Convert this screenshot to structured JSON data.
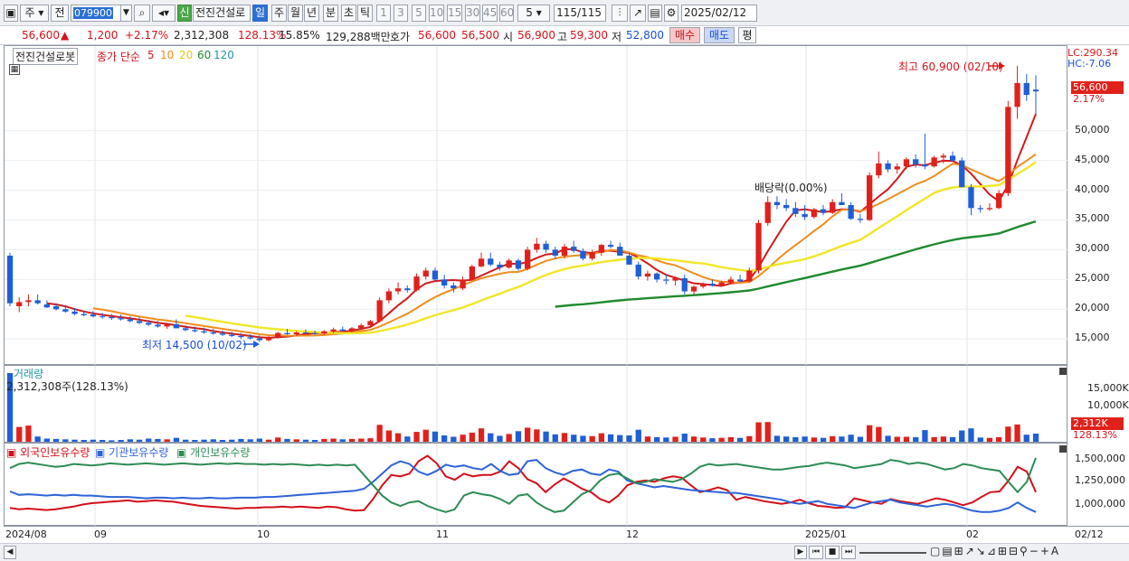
{
  "toolbar": {
    "market": "주",
    "market2": "전",
    "code": "079900",
    "name_badge": "신",
    "stock_name": "전진건설로",
    "periods": [
      "일",
      "주",
      "월",
      "년",
      "분",
      "초",
      "틱"
    ],
    "intervals": [
      "1",
      "3",
      "5",
      "10",
      "15",
      "30",
      "45",
      "60"
    ],
    "interval_value": "5",
    "count": "115/115",
    "date": "2025/02/12"
  },
  "quote": {
    "price": "56,600",
    "arrow": "▲",
    "change": "1,200",
    "change_pct": "+2.17%",
    "volume": "2,312,308",
    "vol_ratio": "128.13%",
    "turnover": "15.85%",
    "amount": "129,288백만",
    "ask_label": "호가",
    "ask": "56,600",
    "bid": "56,500",
    "open_label": "시",
    "open": "56,900",
    "high_label": "고",
    "high": "59,300",
    "low_label": "저",
    "low": "52,800",
    "buy_button": "매수",
    "sell_button": "매도",
    "eval_button": "평"
  },
  "price_pane": {
    "name_tag": "전진건설로봇",
    "legend_label": "종가 단순",
    "ma_labels": [
      "5",
      "10",
      "20",
      "60",
      "120"
    ],
    "lc_label": "LC:290.34",
    "hc_label": "HC:-7.06",
    "last_price_tag": "56,600",
    "last_pct_tag": "2.17%",
    "high_note": "최고 60,900 (02/10)",
    "low_note": "최저 14,500 (10/02)",
    "dividend_note": "배당락(0.00%)",
    "y_ticks": [
      "50,000",
      "45,000",
      "40,000",
      "35,000",
      "30,000",
      "25,000",
      "20,000",
      "15,000"
    ]
  },
  "volume_pane": {
    "title": "거래량",
    "current": "2,312,308주(128.13%)",
    "y_ticks": [
      "15,000K",
      "10,000K"
    ],
    "last_tag": "2,312K",
    "last_pct_tag": "128.13%"
  },
  "holdings_pane": {
    "legend": [
      "외국인보유수량",
      "기관보유수량",
      "개인보유수량"
    ],
    "y_ticks": [
      "1,500,000",
      "1,250,000",
      "1,000,000"
    ]
  },
  "xaxis": {
    "labels": [
      "2024/08",
      "09",
      "10",
      "11",
      "12",
      "2025/01",
      "02"
    ],
    "right_label": "02/12"
  },
  "colors": {
    "up": "#e0211b",
    "down": "#1f5fd6",
    "ma5": "#d01c1c",
    "ma10": "#f08c1e",
    "ma20": "#f2e626",
    "ma60": "#1f8a2e",
    "ma120": "#2196a8",
    "foreign": "#d40f1a",
    "institution": "#2e63d8",
    "individual": "#2d8c55"
  },
  "chart_data": {
    "type": "candlestick",
    "series_note": "daily OHLC, ~115 sessions from 2024/08 to 2025/02/12",
    "y_range": [
      12000,
      63000
    ],
    "ohlc": [
      [
        29000,
        29500,
        20500,
        21000
      ],
      [
        20500,
        22000,
        19500,
        21200
      ],
      [
        21200,
        22500,
        20500,
        21500
      ],
      [
        21500,
        22500,
        20800,
        21000
      ],
      [
        20800,
        21500,
        20200,
        20300
      ],
      [
        20500,
        21000,
        19800,
        20000
      ],
      [
        20000,
        20700,
        19400,
        19600
      ],
      [
        19600,
        20200,
        19000,
        19200
      ],
      [
        19200,
        19800,
        18800,
        19000
      ],
      [
        19100,
        19700,
        18600,
        18800
      ],
      [
        18800,
        19400,
        18400,
        18700
      ],
      [
        18700,
        19200,
        18200,
        18500
      ],
      [
        18500,
        19100,
        18100,
        18300
      ],
      [
        18300,
        18800,
        17800,
        18000
      ],
      [
        18000,
        18700,
        17500,
        17700
      ],
      [
        17700,
        18200,
        17200,
        17400
      ],
      [
        17400,
        18000,
        16900,
        17100
      ],
      [
        17100,
        17700,
        16700,
        17500
      ],
      [
        17500,
        18300,
        17000,
        16800
      ],
      [
        16800,
        17300,
        16300,
        16500
      ],
      [
        16500,
        17100,
        16100,
        16300
      ],
      [
        16300,
        16900,
        15900,
        16100
      ],
      [
        16100,
        16700,
        15700,
        15900
      ],
      [
        15900,
        16400,
        15500,
        15700
      ],
      [
        15700,
        16200,
        15300,
        15500
      ],
      [
        15500,
        16000,
        15000,
        15300
      ],
      [
        15300,
        15800,
        14900,
        15100
      ],
      [
        15100,
        15600,
        14500,
        14800
      ],
      [
        14800,
        15500,
        14600,
        15300
      ],
      [
        15300,
        16200,
        15100,
        16000
      ],
      [
        16000,
        16700,
        15700,
        15800
      ],
      [
        15800,
        16300,
        15500,
        16100
      ],
      [
        16100,
        16600,
        15800,
        16000
      ],
      [
        16000,
        16400,
        15700,
        15900
      ],
      [
        15900,
        16500,
        15700,
        16300
      ],
      [
        16300,
        16900,
        16000,
        16600
      ],
      [
        16600,
        17100,
        16300,
        16400
      ],
      [
        16400,
        17000,
        16100,
        16800
      ],
      [
        16800,
        17600,
        16600,
        17300
      ],
      [
        17300,
        18200,
        17100,
        18000
      ],
      [
        18000,
        22000,
        17800,
        21500
      ],
      [
        21500,
        23500,
        21000,
        23000
      ],
      [
        23000,
        24500,
        22500,
        23500
      ],
      [
        23500,
        24000,
        22800,
        23200
      ],
      [
        23200,
        26000,
        23000,
        25500
      ],
      [
        25500,
        27000,
        25000,
        26500
      ],
      [
        26500,
        27000,
        24800,
        25000
      ],
      [
        25000,
        25800,
        23500,
        24000
      ],
      [
        24000,
        24500,
        22800,
        23500
      ],
      [
        23500,
        25500,
        23200,
        25000
      ],
      [
        25000,
        27500,
        24800,
        27200
      ],
      [
        27200,
        29500,
        27000,
        28500
      ],
      [
        28500,
        29500,
        27200,
        27500
      ],
      [
        27500,
        28000,
        26500,
        27000
      ],
      [
        27000,
        28500,
        26800,
        28200
      ],
      [
        28200,
        28500,
        26500,
        26800
      ],
      [
        26800,
        30500,
        26500,
        30000
      ],
      [
        30000,
        32000,
        29500,
        31000
      ],
      [
        31000,
        31500,
        29500,
        30000
      ],
      [
        30000,
        30500,
        28500,
        29000
      ],
      [
        29000,
        31000,
        28500,
        30500
      ],
      [
        30500,
        31500,
        29500,
        29800
      ],
      [
        29800,
        30200,
        28200,
        28500
      ],
      [
        28500,
        30000,
        28200,
        29500
      ],
      [
        29500,
        31000,
        29000,
        30800
      ],
      [
        30800,
        31500,
        30200,
        30500
      ],
      [
        30500,
        31200,
        29500,
        29000
      ],
      [
        29000,
        29500,
        27500,
        27500
      ],
      [
        27500,
        28000,
        25000,
        25500
      ],
      [
        25500,
        26500,
        24800,
        26000
      ],
      [
        26000,
        26200,
        24500,
        25000
      ],
      [
        25000,
        25800,
        24200,
        24800
      ],
      [
        24800,
        25500,
        24000,
        25200
      ],
      [
        25200,
        25800,
        22500,
        23000
      ],
      [
        23000,
        24000,
        22500,
        23800
      ],
      [
        23800,
        24500,
        23500,
        24300
      ],
      [
        24300,
        25000,
        23800,
        24000
      ],
      [
        24000,
        24800,
        23800,
        24500
      ],
      [
        24500,
        25500,
        24200,
        25000
      ],
      [
        25000,
        25800,
        24600,
        24700
      ],
      [
        24700,
        27000,
        24500,
        26500
      ],
      [
        26500,
        35000,
        26000,
        34500
      ],
      [
        34500,
        39000,
        34000,
        38000
      ],
      [
        38000,
        39000,
        36800,
        37500
      ],
      [
        37500,
        38500,
        36500,
        37000
      ],
      [
        37000,
        38000,
        35500,
        36000
      ],
      [
        36000,
        37500,
        35000,
        35500
      ],
      [
        35500,
        37000,
        35200,
        36800
      ],
      [
        36800,
        37500,
        35800,
        36200
      ],
      [
        36200,
        38500,
        36000,
        38000
      ],
      [
        38000,
        39500,
        37500,
        37500
      ],
      [
        37500,
        38000,
        35000,
        35200
      ],
      [
        35200,
        36000,
        34500,
        35000
      ],
      [
        35000,
        43000,
        34800,
        42500
      ],
      [
        42500,
        46500,
        42000,
        44500
      ],
      [
        44500,
        45000,
        43000,
        43500
      ],
      [
        43500,
        44500,
        42800,
        44000
      ],
      [
        44000,
        45500,
        43500,
        45200
      ],
      [
        45200,
        46000,
        43800,
        44300
      ],
      [
        44300,
        49500,
        43500,
        44000
      ],
      [
        44000,
        45800,
        43800,
        45500
      ],
      [
        45500,
        46200,
        44500,
        45800
      ],
      [
        45800,
        46500,
        44800,
        45000
      ],
      [
        45000,
        45500,
        40500,
        40500
      ],
      [
        40500,
        41000,
        35800,
        37000
      ],
      [
        37000,
        37500,
        36200,
        36800
      ],
      [
        36800,
        37800,
        36500,
        37000
      ],
      [
        37000,
        40000,
        36800,
        39500
      ],
      [
        39500,
        55000,
        39000,
        54000
      ],
      [
        54000,
        60900,
        52000,
        58000
      ],
      [
        58000,
        59500,
        55000,
        56000
      ],
      [
        56900,
        59300,
        52800,
        56600
      ]
    ],
    "ma_series": [
      {
        "name": "5",
        "color": "#d01c1c"
      },
      {
        "name": "10",
        "color": "#f08c1e"
      },
      {
        "name": "20",
        "color": "#f2e626"
      },
      {
        "name": "60",
        "color": "#1f8a2e"
      }
    ],
    "volume_range": [
      0,
      20000
    ],
    "volume_k": [
      19500,
      4200,
      4600,
      1500,
      900,
      800,
      700,
      600,
      500,
      600,
      500,
      400,
      500,
      700,
      600,
      900,
      800,
      700,
      1100,
      600,
      500,
      600,
      700,
      500,
      600,
      800,
      700,
      900,
      600,
      1200,
      800,
      700,
      600,
      500,
      800,
      900,
      700,
      800,
      900,
      1000,
      4800,
      3200,
      2400,
      1500,
      2800,
      3400,
      2900,
      1800,
      1400,
      2000,
      2600,
      3800,
      2400,
      1700,
      2200,
      3000,
      4000,
      3500,
      2900,
      2100,
      2500,
      2000,
      1700,
      1600,
      2400,
      2100,
      1900,
      1800,
      3400,
      1500,
      1300,
      1200,
      1400,
      2300,
      1500,
      1200,
      1000,
      1100,
      1300,
      1100,
      1600,
      5500,
      5600,
      1700,
      1500,
      1300,
      1500,
      1200,
      1100,
      1600,
      1500,
      2000,
      1400,
      4700,
      4200,
      1700,
      1400,
      1400,
      1300,
      3300,
      1300,
      1500,
      1300,
      3200,
      3800,
      1200,
      1100,
      1300,
      4300,
      4900,
      2000,
      2312
    ],
    "holdings": {
      "foreign": [
        0.22,
        0.2,
        0.21,
        0.2,
        0.19,
        0.2,
        0.22,
        0.24,
        0.27,
        0.29,
        0.3,
        0.31,
        0.32,
        0.33,
        0.31,
        0.32,
        0.33,
        0.32,
        0.31,
        0.29,
        0.27,
        0.25,
        0.24,
        0.23,
        0.22,
        0.21,
        0.22,
        0.22,
        0.23,
        0.23,
        0.24,
        0.23,
        0.24,
        0.23,
        0.22,
        0.24,
        0.23,
        0.2,
        0.18,
        0.19,
        0.35,
        0.55,
        0.7,
        0.68,
        0.72,
        0.9,
        0.98,
        0.87,
        0.68,
        0.63,
        0.72,
        0.68,
        0.7,
        0.7,
        0.75,
        0.9,
        0.8,
        0.64,
        0.58,
        0.45,
        0.56,
        0.65,
        0.58,
        0.5,
        0.45,
        0.35,
        0.3,
        0.4,
        0.55,
        0.6,
        0.62,
        0.6,
        0.65,
        0.68,
        0.66,
        0.55,
        0.45,
        0.48,
        0.52,
        0.48,
        0.34,
        0.38,
        0.35,
        0.32,
        0.3,
        0.28,
        0.3,
        0.34,
        0.29,
        0.25,
        0.24,
        0.22,
        0.23,
        0.36,
        0.33,
        0.3,
        0.28,
        0.35,
        0.32,
        0.3,
        0.28,
        0.32,
        0.36,
        0.34,
        0.3,
        0.26,
        0.3,
        0.38,
        0.45,
        0.46,
        0.62,
        0.82,
        0.75,
        0.45
      ],
      "institution": [
        0.46,
        0.41,
        0.42,
        0.41,
        0.4,
        0.41,
        0.4,
        0.41,
        0.4,
        0.4,
        0.39,
        0.38,
        0.38,
        0.38,
        0.37,
        0.36,
        0.37,
        0.37,
        0.36,
        0.37,
        0.36,
        0.36,
        0.37,
        0.36,
        0.36,
        0.37,
        0.37,
        0.37,
        0.38,
        0.38,
        0.39,
        0.4,
        0.41,
        0.42,
        0.43,
        0.44,
        0.45,
        0.46,
        0.47,
        0.5,
        0.6,
        0.72,
        0.84,
        0.9,
        0.86,
        0.75,
        0.7,
        0.76,
        0.85,
        0.82,
        0.84,
        0.8,
        0.78,
        0.86,
        0.76,
        0.7,
        0.72,
        0.9,
        0.92,
        0.8,
        0.74,
        0.7,
        0.76,
        0.78,
        0.72,
        0.7,
        0.78,
        0.75,
        0.62,
        0.58,
        0.55,
        0.52,
        0.54,
        0.52,
        0.5,
        0.48,
        0.47,
        0.46,
        0.45,
        0.44,
        0.44,
        0.42,
        0.4,
        0.38,
        0.36,
        0.34,
        0.3,
        0.28,
        0.3,
        0.32,
        0.28,
        0.26,
        0.24,
        0.22,
        0.26,
        0.3,
        0.32,
        0.34,
        0.3,
        0.28,
        0.26,
        0.24,
        0.26,
        0.28,
        0.26,
        0.22,
        0.18,
        0.16,
        0.16,
        0.18,
        0.22,
        0.3,
        0.22,
        0.16
      ],
      "individual": [
        0.8,
        0.86,
        0.88,
        0.86,
        0.84,
        0.82,
        0.83,
        0.86,
        0.85,
        0.84,
        0.85,
        0.87,
        0.86,
        0.85,
        0.86,
        0.87,
        0.86,
        0.85,
        0.86,
        0.87,
        0.86,
        0.85,
        0.86,
        0.87,
        0.86,
        0.87,
        0.86,
        0.86,
        0.85,
        0.86,
        0.85,
        0.86,
        0.85,
        0.84,
        0.85,
        0.84,
        0.85,
        0.84,
        0.85,
        0.7,
        0.55,
        0.4,
        0.3,
        0.25,
        0.3,
        0.32,
        0.25,
        0.2,
        0.16,
        0.2,
        0.4,
        0.45,
        0.42,
        0.4,
        0.35,
        0.28,
        0.4,
        0.42,
        0.3,
        0.22,
        0.16,
        0.18,
        0.3,
        0.42,
        0.48,
        0.62,
        0.7,
        0.72,
        0.65,
        0.58,
        0.6,
        0.64,
        0.62,
        0.6,
        0.64,
        0.72,
        0.82,
        0.86,
        0.84,
        0.85,
        0.86,
        0.84,
        0.82,
        0.8,
        0.78,
        0.78,
        0.8,
        0.82,
        0.83,
        0.86,
        0.88,
        0.86,
        0.84,
        0.8,
        0.82,
        0.84,
        0.86,
        0.92,
        0.9,
        0.86,
        0.88,
        0.86,
        0.82,
        0.78,
        0.8,
        0.86,
        0.84,
        0.8,
        0.78,
        0.76,
        0.6,
        0.45,
        0.6,
        0.95
      ]
    }
  }
}
